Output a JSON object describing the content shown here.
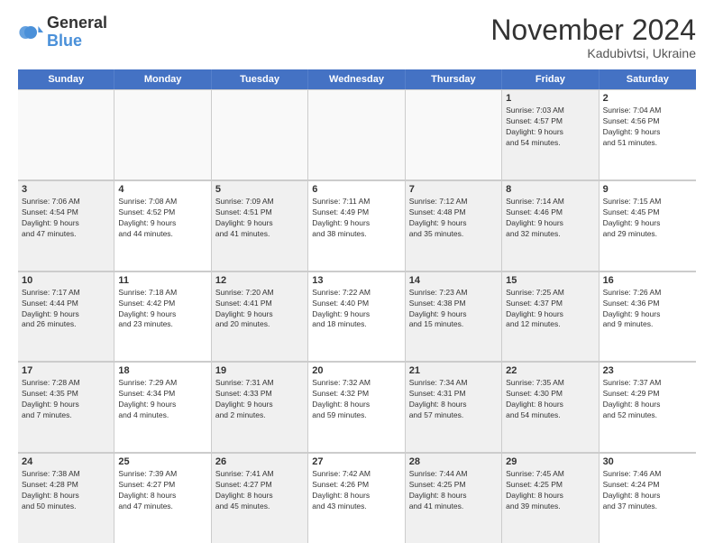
{
  "logo": {
    "text_general": "General",
    "text_blue": "Blue"
  },
  "header": {
    "month": "November 2024",
    "location": "Kadubivtsi, Ukraine"
  },
  "weekdays": [
    "Sunday",
    "Monday",
    "Tuesday",
    "Wednesday",
    "Thursday",
    "Friday",
    "Saturday"
  ],
  "rows": [
    [
      {
        "day": "",
        "info": "",
        "empty": true
      },
      {
        "day": "",
        "info": "",
        "empty": true
      },
      {
        "day": "",
        "info": "",
        "empty": true
      },
      {
        "day": "",
        "info": "",
        "empty": true
      },
      {
        "day": "",
        "info": "",
        "empty": true
      },
      {
        "day": "1",
        "info": "Sunrise: 7:03 AM\nSunset: 4:57 PM\nDaylight: 9 hours\nand 54 minutes.",
        "shaded": true
      },
      {
        "day": "2",
        "info": "Sunrise: 7:04 AM\nSunset: 4:56 PM\nDaylight: 9 hours\nand 51 minutes.",
        "shaded": false
      }
    ],
    [
      {
        "day": "3",
        "info": "Sunrise: 7:06 AM\nSunset: 4:54 PM\nDaylight: 9 hours\nand 47 minutes.",
        "shaded": true
      },
      {
        "day": "4",
        "info": "Sunrise: 7:08 AM\nSunset: 4:52 PM\nDaylight: 9 hours\nand 44 minutes.",
        "shaded": false
      },
      {
        "day": "5",
        "info": "Sunrise: 7:09 AM\nSunset: 4:51 PM\nDaylight: 9 hours\nand 41 minutes.",
        "shaded": true
      },
      {
        "day": "6",
        "info": "Sunrise: 7:11 AM\nSunset: 4:49 PM\nDaylight: 9 hours\nand 38 minutes.",
        "shaded": false
      },
      {
        "day": "7",
        "info": "Sunrise: 7:12 AM\nSunset: 4:48 PM\nDaylight: 9 hours\nand 35 minutes.",
        "shaded": true
      },
      {
        "day": "8",
        "info": "Sunrise: 7:14 AM\nSunset: 4:46 PM\nDaylight: 9 hours\nand 32 minutes.",
        "shaded": true
      },
      {
        "day": "9",
        "info": "Sunrise: 7:15 AM\nSunset: 4:45 PM\nDaylight: 9 hours\nand 29 minutes.",
        "shaded": false
      }
    ],
    [
      {
        "day": "10",
        "info": "Sunrise: 7:17 AM\nSunset: 4:44 PM\nDaylight: 9 hours\nand 26 minutes.",
        "shaded": true
      },
      {
        "day": "11",
        "info": "Sunrise: 7:18 AM\nSunset: 4:42 PM\nDaylight: 9 hours\nand 23 minutes.",
        "shaded": false
      },
      {
        "day": "12",
        "info": "Sunrise: 7:20 AM\nSunset: 4:41 PM\nDaylight: 9 hours\nand 20 minutes.",
        "shaded": true
      },
      {
        "day": "13",
        "info": "Sunrise: 7:22 AM\nSunset: 4:40 PM\nDaylight: 9 hours\nand 18 minutes.",
        "shaded": false
      },
      {
        "day": "14",
        "info": "Sunrise: 7:23 AM\nSunset: 4:38 PM\nDaylight: 9 hours\nand 15 minutes.",
        "shaded": true
      },
      {
        "day": "15",
        "info": "Sunrise: 7:25 AM\nSunset: 4:37 PM\nDaylight: 9 hours\nand 12 minutes.",
        "shaded": true
      },
      {
        "day": "16",
        "info": "Sunrise: 7:26 AM\nSunset: 4:36 PM\nDaylight: 9 hours\nand 9 minutes.",
        "shaded": false
      }
    ],
    [
      {
        "day": "17",
        "info": "Sunrise: 7:28 AM\nSunset: 4:35 PM\nDaylight: 9 hours\nand 7 minutes.",
        "shaded": true
      },
      {
        "day": "18",
        "info": "Sunrise: 7:29 AM\nSunset: 4:34 PM\nDaylight: 9 hours\nand 4 minutes.",
        "shaded": false
      },
      {
        "day": "19",
        "info": "Sunrise: 7:31 AM\nSunset: 4:33 PM\nDaylight: 9 hours\nand 2 minutes.",
        "shaded": true
      },
      {
        "day": "20",
        "info": "Sunrise: 7:32 AM\nSunset: 4:32 PM\nDaylight: 8 hours\nand 59 minutes.",
        "shaded": false
      },
      {
        "day": "21",
        "info": "Sunrise: 7:34 AM\nSunset: 4:31 PM\nDaylight: 8 hours\nand 57 minutes.",
        "shaded": true
      },
      {
        "day": "22",
        "info": "Sunrise: 7:35 AM\nSunset: 4:30 PM\nDaylight: 8 hours\nand 54 minutes.",
        "shaded": true
      },
      {
        "day": "23",
        "info": "Sunrise: 7:37 AM\nSunset: 4:29 PM\nDaylight: 8 hours\nand 52 minutes.",
        "shaded": false
      }
    ],
    [
      {
        "day": "24",
        "info": "Sunrise: 7:38 AM\nSunset: 4:28 PM\nDaylight: 8 hours\nand 50 minutes.",
        "shaded": true
      },
      {
        "day": "25",
        "info": "Sunrise: 7:39 AM\nSunset: 4:27 PM\nDaylight: 8 hours\nand 47 minutes.",
        "shaded": false
      },
      {
        "day": "26",
        "info": "Sunrise: 7:41 AM\nSunset: 4:27 PM\nDaylight: 8 hours\nand 45 minutes.",
        "shaded": true
      },
      {
        "day": "27",
        "info": "Sunrise: 7:42 AM\nSunset: 4:26 PM\nDaylight: 8 hours\nand 43 minutes.",
        "shaded": false
      },
      {
        "day": "28",
        "info": "Sunrise: 7:44 AM\nSunset: 4:25 PM\nDaylight: 8 hours\nand 41 minutes.",
        "shaded": true
      },
      {
        "day": "29",
        "info": "Sunrise: 7:45 AM\nSunset: 4:25 PM\nDaylight: 8 hours\nand 39 minutes.",
        "shaded": true
      },
      {
        "day": "30",
        "info": "Sunrise: 7:46 AM\nSunset: 4:24 PM\nDaylight: 8 hours\nand 37 minutes.",
        "shaded": false
      }
    ]
  ]
}
